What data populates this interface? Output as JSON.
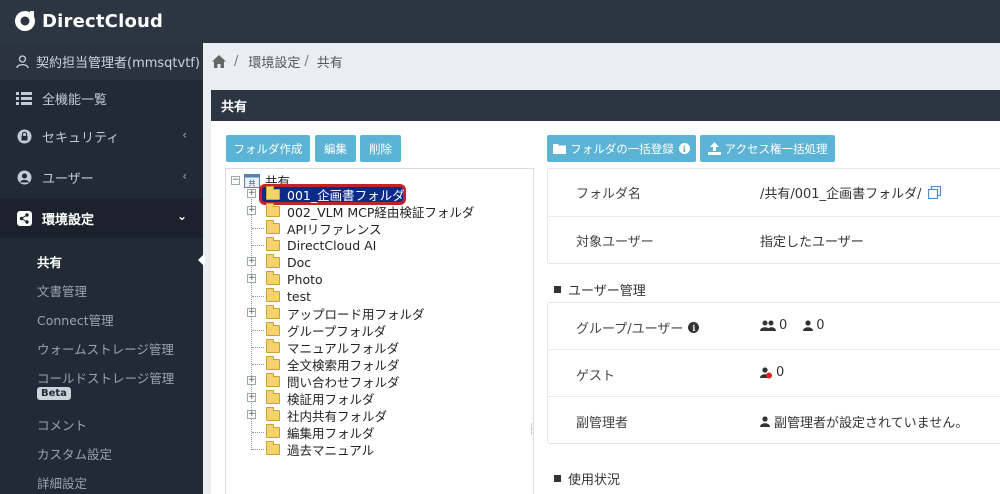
{
  "app": {
    "logo_text": "DirectCloud"
  },
  "sidebar": {
    "user_label": "契約担当管理者(mmsqtvtf)",
    "items": [
      {
        "label": "全機能一覧",
        "icon": "list-icon"
      },
      {
        "label": "セキュリティ",
        "icon": "lock-icon"
      },
      {
        "label": "ユーザー",
        "icon": "user-circle-icon"
      },
      {
        "label": "環境設定",
        "icon": "share-icon"
      }
    ],
    "sub_items": [
      {
        "label": "共有"
      },
      {
        "label": "文書管理"
      },
      {
        "label": "Connect管理"
      },
      {
        "label": "ウォームストレージ管理"
      },
      {
        "label": "コールドストレージ管理"
      },
      {
        "label": "コメント"
      },
      {
        "label": "カスタム設定"
      },
      {
        "label": "詳細設定"
      }
    ],
    "beta_label": "Beta"
  },
  "breadcrumb": {
    "items": [
      "環境設定",
      "共有"
    ]
  },
  "panel": {
    "title": "共有",
    "buttons": {
      "create_folder": "フォルダ作成",
      "edit": "編集",
      "delete": "削除",
      "bulk_register": "フォルダの一括登録",
      "bulk_access": "アクセス権一括処理"
    }
  },
  "tree": {
    "root": "共有",
    "nodes": [
      {
        "label": "001_企画書フォルダ",
        "expandable": true,
        "selected": true
      },
      {
        "label": "002_VLM MCP経由検証フォルダ",
        "expandable": true
      },
      {
        "label": "APIリファレンス",
        "expandable": false
      },
      {
        "label": "DirectCloud AI",
        "expandable": false
      },
      {
        "label": "Doc",
        "expandable": true
      },
      {
        "label": "Photo",
        "expandable": true
      },
      {
        "label": "test",
        "expandable": false
      },
      {
        "label": "アップロード用フォルダ",
        "expandable": true
      },
      {
        "label": "グループフォルダ",
        "expandable": false
      },
      {
        "label": "マニュアルフォルダ",
        "expandable": false
      },
      {
        "label": "全文検索用フォルダ",
        "expandable": false
      },
      {
        "label": "問い合わせフォルダ",
        "expandable": true
      },
      {
        "label": "検証用フォルダ",
        "expandable": true
      },
      {
        "label": "社内共有フォルダ",
        "expandable": true
      },
      {
        "label": "編集用フォルダ",
        "expandable": false
      },
      {
        "label": "過去マニュアル",
        "expandable": false
      }
    ]
  },
  "details": {
    "folder_name_label": "フォルダ名",
    "folder_name_value": "/共有/001_企画書フォルダ/",
    "target_user_label": "対象ユーザー",
    "target_user_value": "指定したユーザー"
  },
  "user_management": {
    "title": "ユーザー管理",
    "group_user_label": "グループ/ユーザー",
    "group_count": "0",
    "user_count": "0",
    "guest_label": "ゲスト",
    "guest_count": "0",
    "sub_admin_label": "副管理者",
    "sub_admin_value": "副管理者が設定されていません。"
  },
  "usage": {
    "title": "使用状況"
  }
}
